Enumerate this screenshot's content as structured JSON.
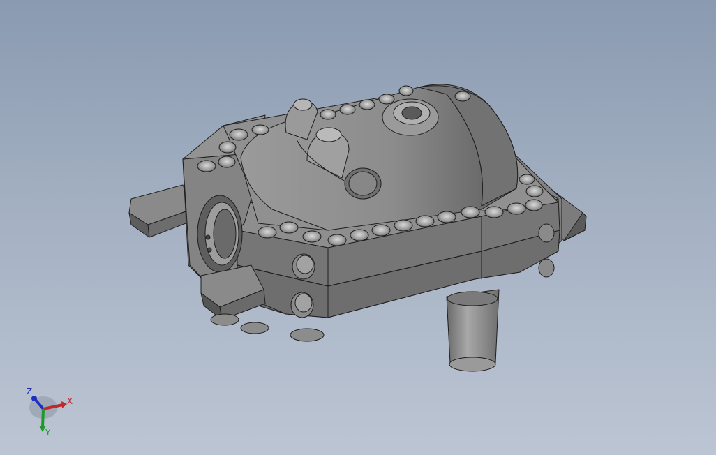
{
  "viewport": {
    "background_top": "#8a9ab0",
    "background_bottom": "#bcc5d3"
  },
  "model": {
    "part_color": "#808080",
    "shade_light": "#a6a6a6",
    "shade_dark": "#555555",
    "edge_color": "#1e1e1e"
  },
  "triad": {
    "x_label": "X",
    "y_label": "Y",
    "z_label": "Z",
    "x_color": "#c0282a",
    "y_color": "#1e9a2a",
    "z_color": "#1e2ec0"
  }
}
